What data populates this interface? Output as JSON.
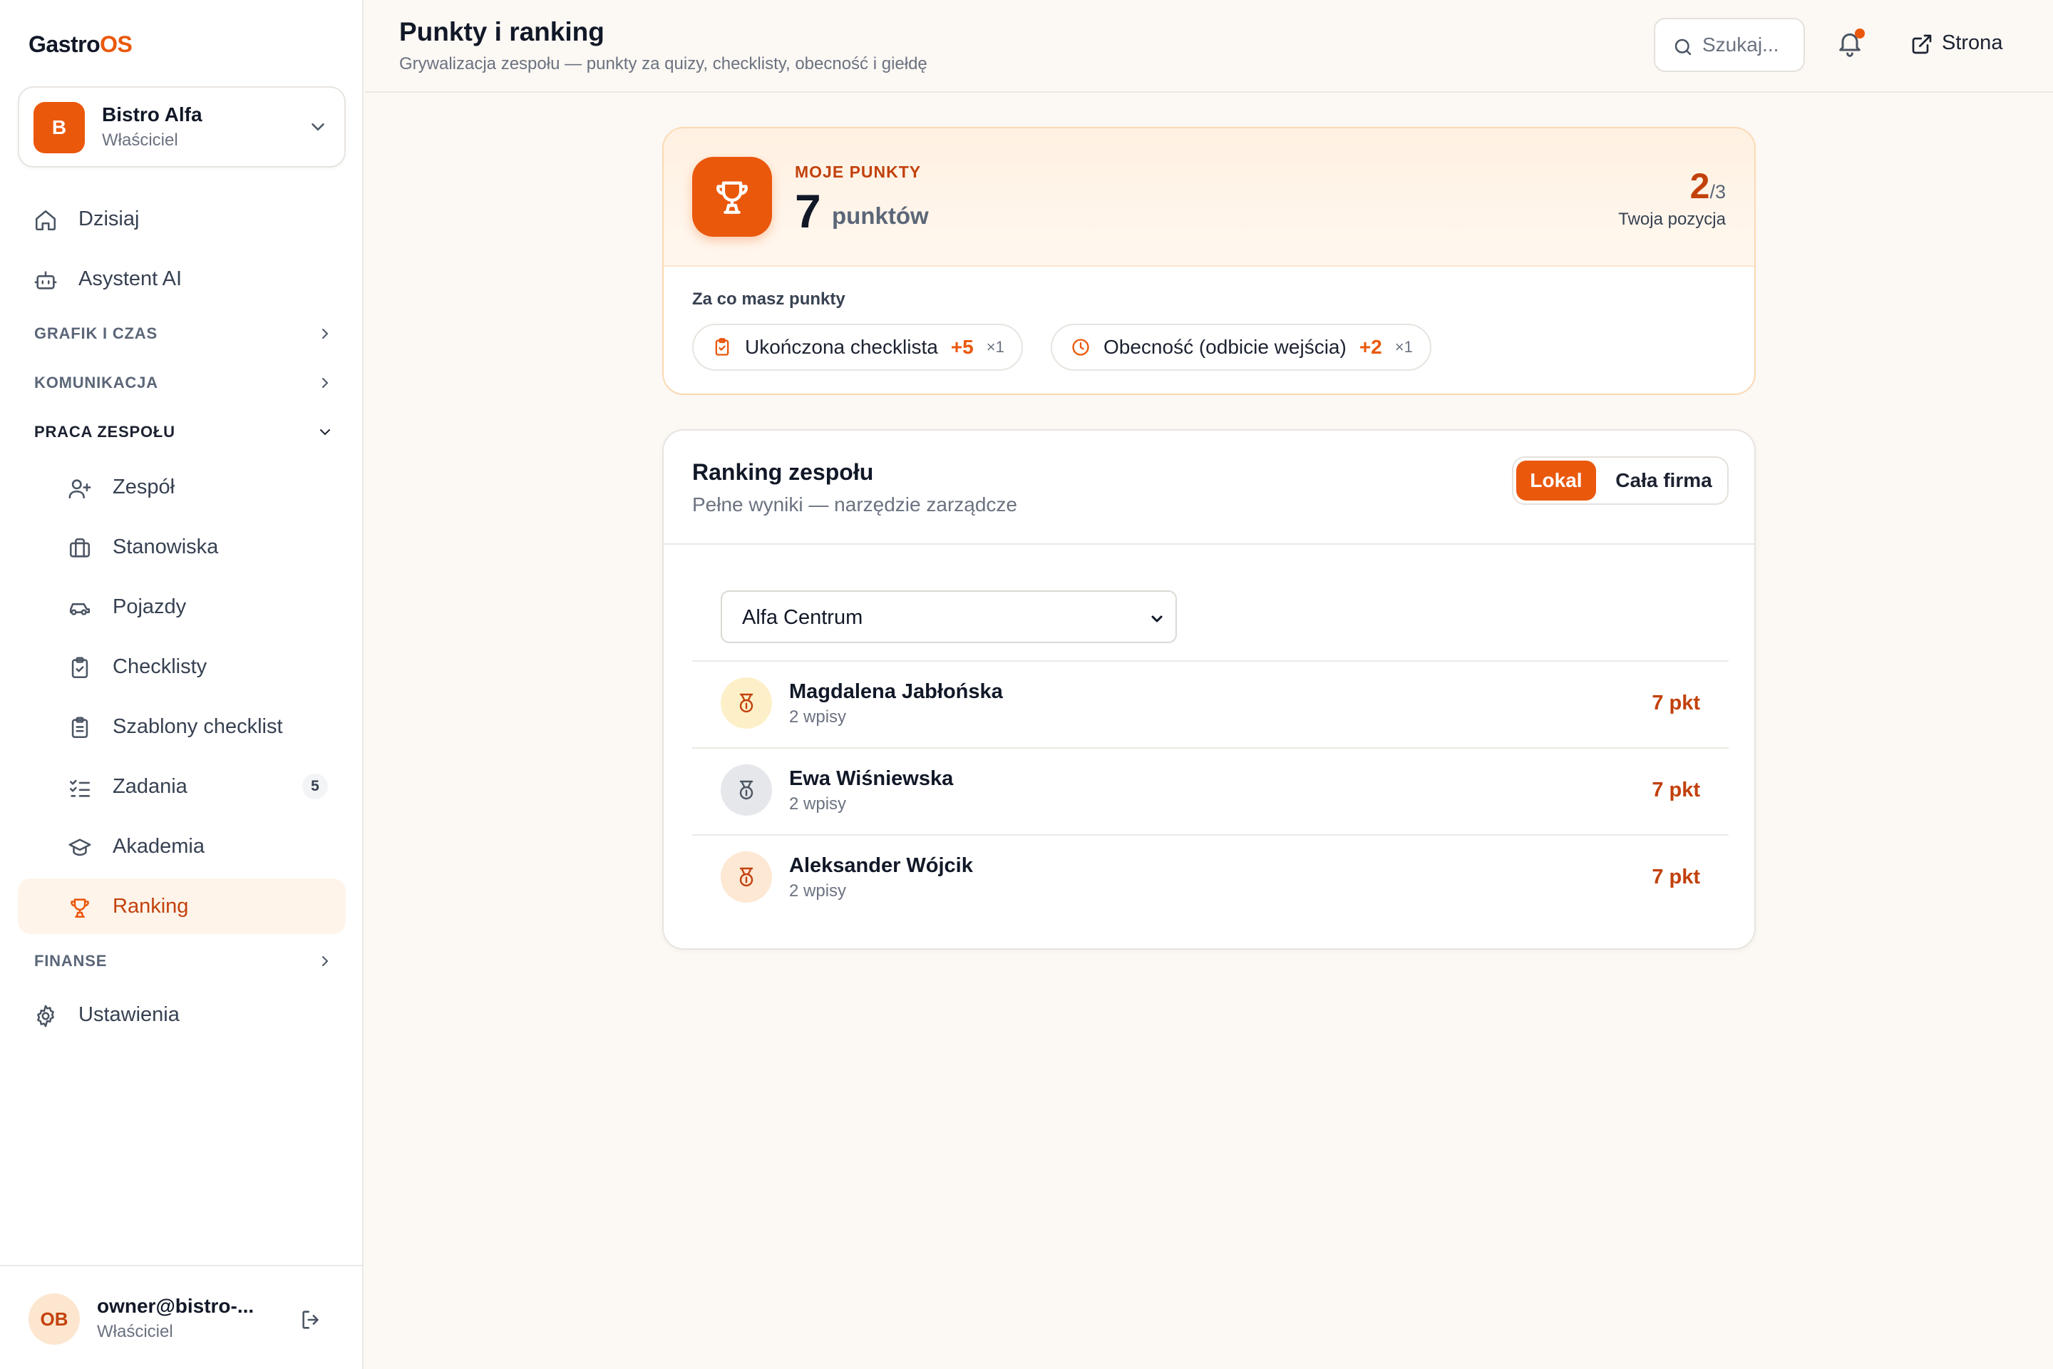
{
  "app": {
    "logo_main": "Gastro",
    "logo_accent": "OS"
  },
  "org": {
    "avatar_letter": "B",
    "name": "Bistro Alfa",
    "role": "Właściciel"
  },
  "nav": {
    "today": "Dzisiaj",
    "assistant": "Asystent AI",
    "section_schedule": "GRAFIK I CZAS",
    "section_communication": "KOMUNIKACJA",
    "section_teamwork": "PRACA ZESPOŁU",
    "team": "Zespół",
    "positions": "Stanowiska",
    "vehicles": "Pojazdy",
    "checklists": "Checklisty",
    "checklist_templates": "Szablony checklist",
    "tasks": "Zadania",
    "tasks_badge": "5",
    "academy": "Akademia",
    "ranking": "Ranking",
    "section_finance": "FINANSE",
    "settings": "Ustawienia"
  },
  "user": {
    "initials": "OB",
    "email": "owner@bistro-...",
    "role": "Właściciel"
  },
  "header": {
    "title": "Punkty i ranking",
    "subtitle": "Grywalizacja zespołu — punkty za quizy, checklisty, obecność i giełdę",
    "search_placeholder": "Szukaj...",
    "site_link": "Strona"
  },
  "points": {
    "label": "MOJE PUNKTY",
    "value": "7",
    "unit": "punktów",
    "position": "2",
    "position_of": "/3",
    "position_label": "Twoja pozycja",
    "earned_label": "Za co masz punkty",
    "chips": [
      {
        "label": "Ukończona checklista",
        "points": "+5",
        "count": "×1"
      },
      {
        "label": "Obecność (odbicie wejścia)",
        "points": "+2",
        "count": "×1"
      }
    ]
  },
  "ranking": {
    "title": "Ranking zespołu",
    "subtitle": "Pełne wyniki — narzędzie zarządcze",
    "scope_local": "Lokal",
    "scope_company": "Cała firma",
    "location": "Alfa Centrum",
    "rows": [
      {
        "name": "Magdalena Jabłońska",
        "entries": "2 wpisy",
        "points": "7 pkt",
        "medal": "gold"
      },
      {
        "name": "Ewa Wiśniewska",
        "entries": "2 wpisy",
        "points": "7 pkt",
        "medal": "silver"
      },
      {
        "name": "Aleksander Wójcik",
        "entries": "2 wpisy",
        "points": "7 pkt",
        "medal": "bronze"
      }
    ]
  },
  "colors": {
    "accent": "#ea580c",
    "accent_dark": "#c2410c",
    "background": "#fcf8f4"
  }
}
